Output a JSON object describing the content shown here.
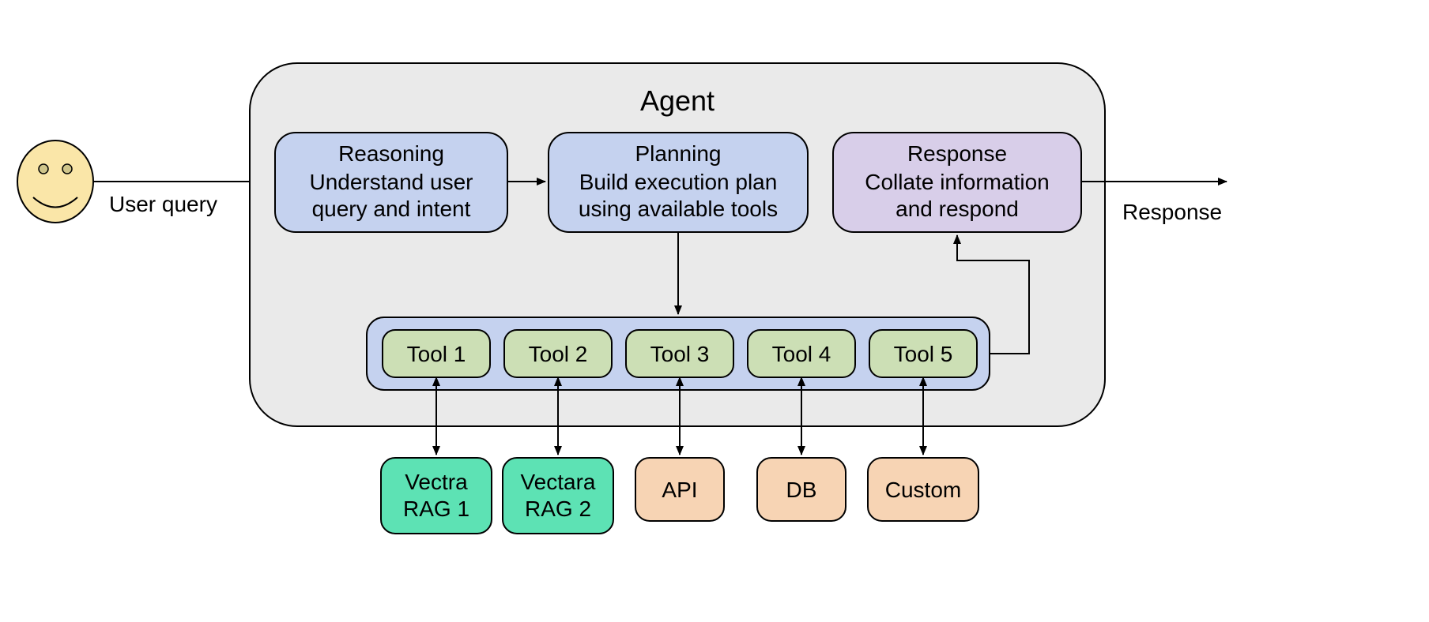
{
  "agent": {
    "title": "Agent",
    "stages": {
      "reasoning": {
        "title": "Reasoning",
        "desc1": "Understand user",
        "desc2": "query and intent"
      },
      "planning": {
        "title": "Planning",
        "desc1": "Build execution plan",
        "desc2": "using available tools"
      },
      "response": {
        "title": "Response",
        "desc1": "Collate information",
        "desc2": "and respond"
      }
    },
    "tools": [
      "Tool 1",
      "Tool 2",
      "Tool 3",
      "Tool 4",
      "Tool 5"
    ],
    "implementations": [
      {
        "line1": "Vectra",
        "line2": "RAG 1"
      },
      {
        "line1": "Vectara",
        "line2": "RAG 2"
      },
      {
        "line1": "API",
        "line2": ""
      },
      {
        "line1": "DB",
        "line2": ""
      },
      {
        "line1": "Custom",
        "line2": ""
      }
    ]
  },
  "labels": {
    "user_query": "User query",
    "response_out": "Response"
  },
  "colors": {
    "agent_bg": "#eaeaea",
    "stage_blue": "#c5d2ef",
    "stage_purple": "#d8cee9",
    "tools_container": "#c5d2ef",
    "tool_bg": "#ccdfb5",
    "impl_green": "#5de2b4",
    "impl_peach": "#f7d4b4",
    "face": "#fae6a8",
    "stroke": "#000000"
  }
}
